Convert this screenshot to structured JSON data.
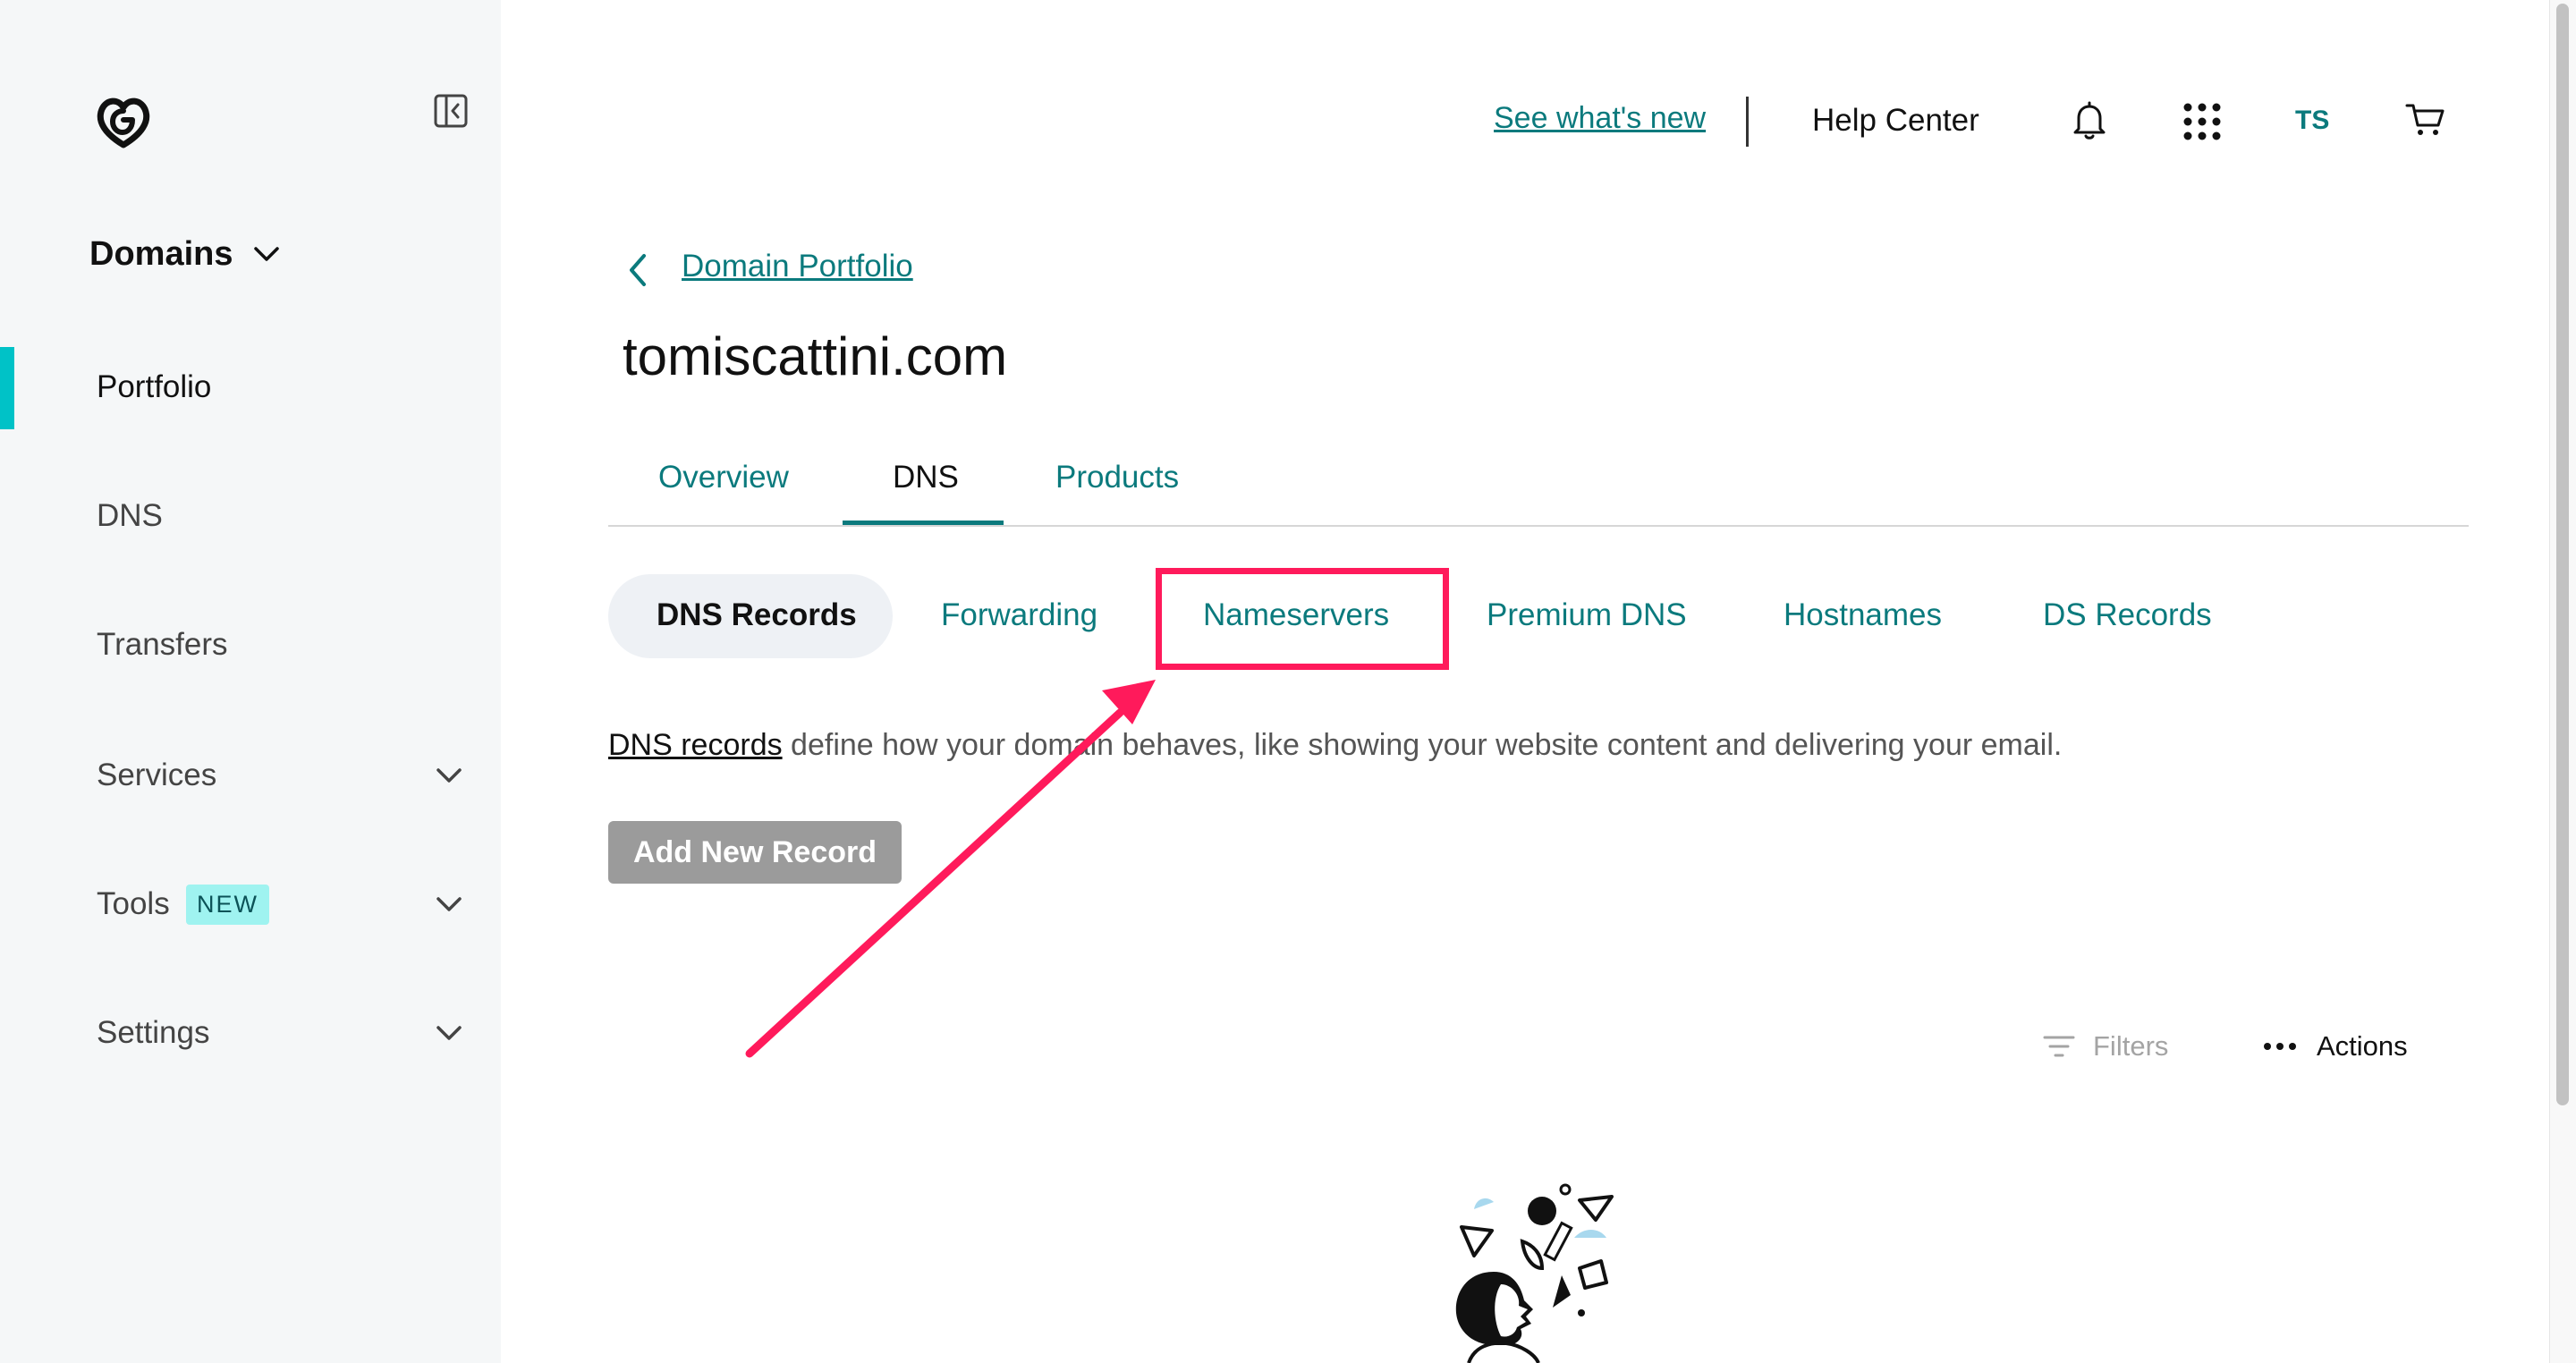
{
  "colors": {
    "accent": "#0b7a7d",
    "active_indicator": "#00c2c7",
    "annotation": "#ff1a5b",
    "sidebar_bg": "#f5f7f8",
    "disabled_button": "#9b9b9b",
    "badge_bg": "#9ff3f0"
  },
  "sidebar": {
    "logo_icon": "godaddy-logo-icon",
    "collapse_icon": "sidebar-collapse-icon",
    "product_label": "Domains",
    "items": [
      {
        "label": "Portfolio",
        "active": true
      },
      {
        "label": "DNS"
      },
      {
        "label": "Transfers"
      },
      {
        "label": "Services",
        "expandable": true
      },
      {
        "label": "Tools",
        "badge": "NEW",
        "expandable": true
      },
      {
        "label": "Settings",
        "expandable": true
      }
    ]
  },
  "header": {
    "whats_new": "See what's new",
    "help_center": "Help Center",
    "icons": [
      "bell-icon",
      "apps-grid-icon",
      "cart-icon"
    ],
    "avatar_initials": "TS"
  },
  "breadcrumb": {
    "label": "Domain Portfolio"
  },
  "page": {
    "title": "tomiscattini.com"
  },
  "tabs": [
    {
      "label": "Overview"
    },
    {
      "label": "DNS",
      "active": true
    },
    {
      "label": "Products"
    }
  ],
  "subtabs": [
    {
      "label": "DNS Records",
      "active": true
    },
    {
      "label": "Forwarding"
    },
    {
      "label": "Nameservers",
      "highlighted": true
    },
    {
      "label": "Premium DNS"
    },
    {
      "label": "Hostnames"
    },
    {
      "label": "DS Records"
    }
  ],
  "description": {
    "link_text": "DNS records",
    "text": " define how your domain behaves, like showing your website content and delivering your email."
  },
  "add_record_button": "Add New Record",
  "toolbar": {
    "filters": "Filters",
    "actions": "Actions"
  }
}
